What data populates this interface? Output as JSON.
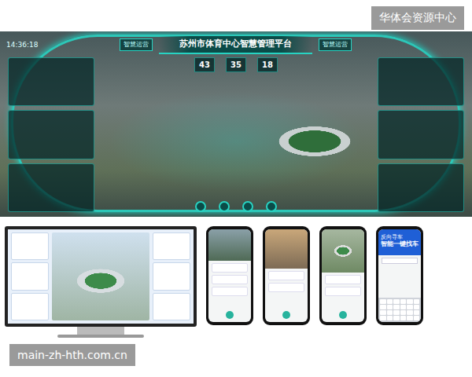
{
  "watermark": {
    "text": "华体会资源中心"
  },
  "dashboard": {
    "title": "苏州市体育中心智慧管理平台",
    "time": "14:36:18",
    "tags": [
      "智慧运营",
      "智慧运营"
    ],
    "stats": [
      "43",
      "35",
      "18"
    ]
  },
  "phone_app": {
    "subtitle": "反向寻车",
    "headline": "智能一键找车"
  },
  "footer": {
    "text": "main-zh-hth.com.cn"
  }
}
